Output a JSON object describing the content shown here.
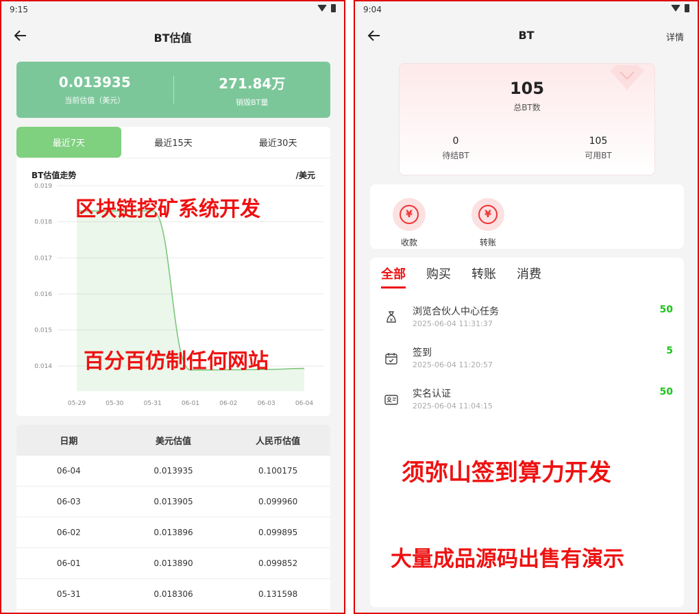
{
  "left": {
    "status_time": "9:15",
    "title": "BT估值",
    "summary": [
      {
        "value": "0.013935",
        "label": "当前估值（美元）"
      },
      {
        "value": "271.84万",
        "label": "销毁BT量"
      }
    ],
    "tabs": [
      {
        "label": "最近7天",
        "active": true
      },
      {
        "label": "最近15天",
        "active": false
      },
      {
        "label": "最近30天",
        "active": false
      }
    ],
    "chart_title": "BT估值走势",
    "chart_unit": "/美元",
    "table": {
      "headers": [
        "日期",
        "美元估值",
        "人民币估值"
      ],
      "rows": [
        [
          "06-04",
          "0.013935",
          "0.100175"
        ],
        [
          "06-03",
          "0.013905",
          "0.099960"
        ],
        [
          "06-02",
          "0.013896",
          "0.099895"
        ],
        [
          "06-01",
          "0.013890",
          "0.099852"
        ],
        [
          "05-31",
          "0.018306",
          "0.131598"
        ]
      ]
    },
    "overlay_1": "区块链挖矿系统开发",
    "overlay_2": "百分百仿制任何网站"
  },
  "chart_data": {
    "type": "area",
    "title": "BT估值走势",
    "ylabel": "/美元",
    "x": [
      "05-29",
      "05-30",
      "05-31",
      "06-01",
      "06-02",
      "06-03",
      "06-04"
    ],
    "yticks": [
      "0.019",
      "0.018",
      "0.017",
      "0.016",
      "0.015",
      "0.014"
    ],
    "ylim": [
      0.0133,
      0.019
    ],
    "series": [
      {
        "values": [
          0.0183,
          0.0183,
          0.018306,
          0.01389,
          0.013896,
          0.013905,
          0.013935
        ]
      }
    ],
    "grid": true,
    "color": "#7cc77c"
  },
  "right": {
    "status_time": "9:04",
    "title": "BT",
    "detail_label": "详情",
    "total": "105",
    "total_label": "总BT数",
    "pending": "0",
    "pending_label": "待结BT",
    "available": "105",
    "available_label": "可用BT",
    "actions": [
      {
        "label": "收款",
        "icon": "¥"
      },
      {
        "label": "转账",
        "icon": "¥"
      }
    ],
    "tabs": [
      {
        "label": "全部",
        "active": true
      },
      {
        "label": "购买",
        "active": false
      },
      {
        "label": "转账",
        "active": false
      },
      {
        "label": "消费",
        "active": false
      }
    ],
    "records": [
      {
        "title": "浏览合伙人中心任务",
        "time": "2025-06-04 11:31:37",
        "value": "50",
        "icon": "money-bag-icon"
      },
      {
        "title": "签到",
        "time": "2025-06-04 11:20:57",
        "value": "5",
        "icon": "calendar-check-icon"
      },
      {
        "title": "实名认证",
        "time": "2025-06-04 11:04:15",
        "value": "50",
        "icon": "id-card-icon"
      }
    ],
    "overlay_1": "须弥山签到算力开发",
    "overlay_2": "大量成品源码出售有演示"
  }
}
